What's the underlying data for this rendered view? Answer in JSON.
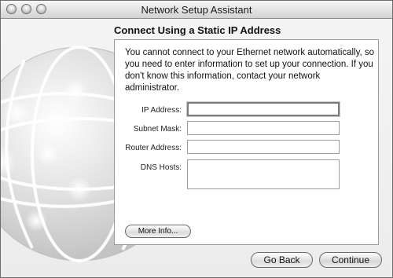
{
  "window": {
    "title": "Network Setup Assistant"
  },
  "page": {
    "heading": "Connect Using a Static IP Address",
    "description": "You cannot connect to your Ethernet network automatically, so you need to enter information to set up your connection. If you don't know this information, contact your network administrator."
  },
  "form": {
    "ip_label": "IP Address:",
    "ip_value": "",
    "subnet_label": "Subnet Mask:",
    "subnet_value": "",
    "router_label": "Router Address:",
    "router_value": "",
    "dns_label": "DNS Hosts:",
    "dns_value": ""
  },
  "buttons": {
    "more_info": "More Info...",
    "go_back": "Go Back",
    "continue": "Continue"
  },
  "icons": {
    "window_controls": [
      "close-icon",
      "minimize-icon",
      "zoom-icon"
    ],
    "illustration": "globe-network-icon"
  }
}
